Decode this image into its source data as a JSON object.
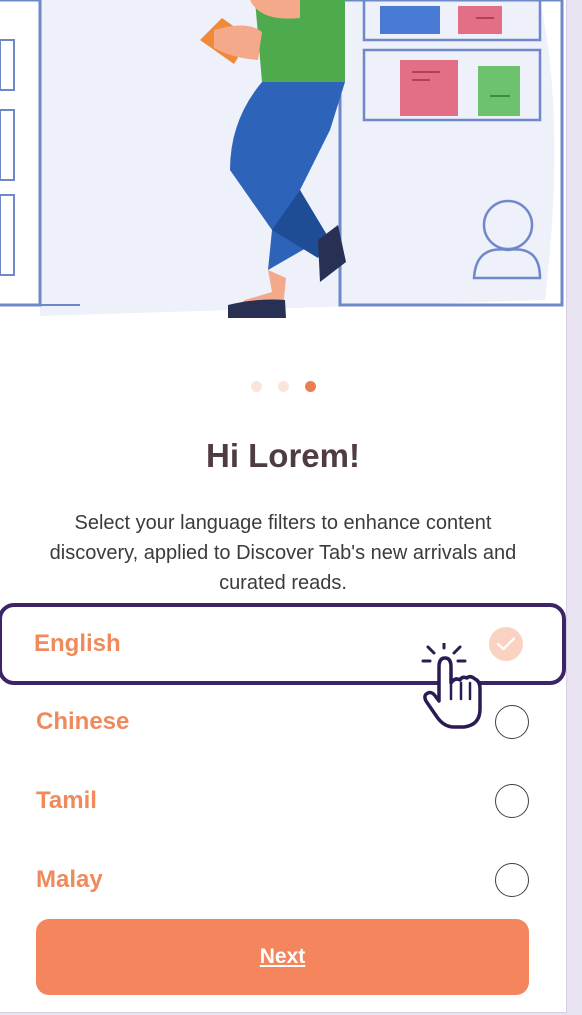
{
  "onboarding": {
    "pager": {
      "count": 3,
      "active_index": 2
    },
    "title": "Hi Lorem!",
    "subtitle": "Select your language filters to enhance content discovery, applied to Discover Tab's new arrivals and curated reads."
  },
  "languages": [
    {
      "label": "English",
      "selected": true
    },
    {
      "label": "Chinese",
      "selected": false
    },
    {
      "label": "Tamil",
      "selected": false
    },
    {
      "label": "Malay",
      "selected": false
    }
  ],
  "next_label": "Next",
  "colors": {
    "accent": "#f4855c",
    "label": "#ef8a5c",
    "title": "#4f3c43",
    "highlight": "#3d2466",
    "checked_fill": "#fad2c2"
  }
}
